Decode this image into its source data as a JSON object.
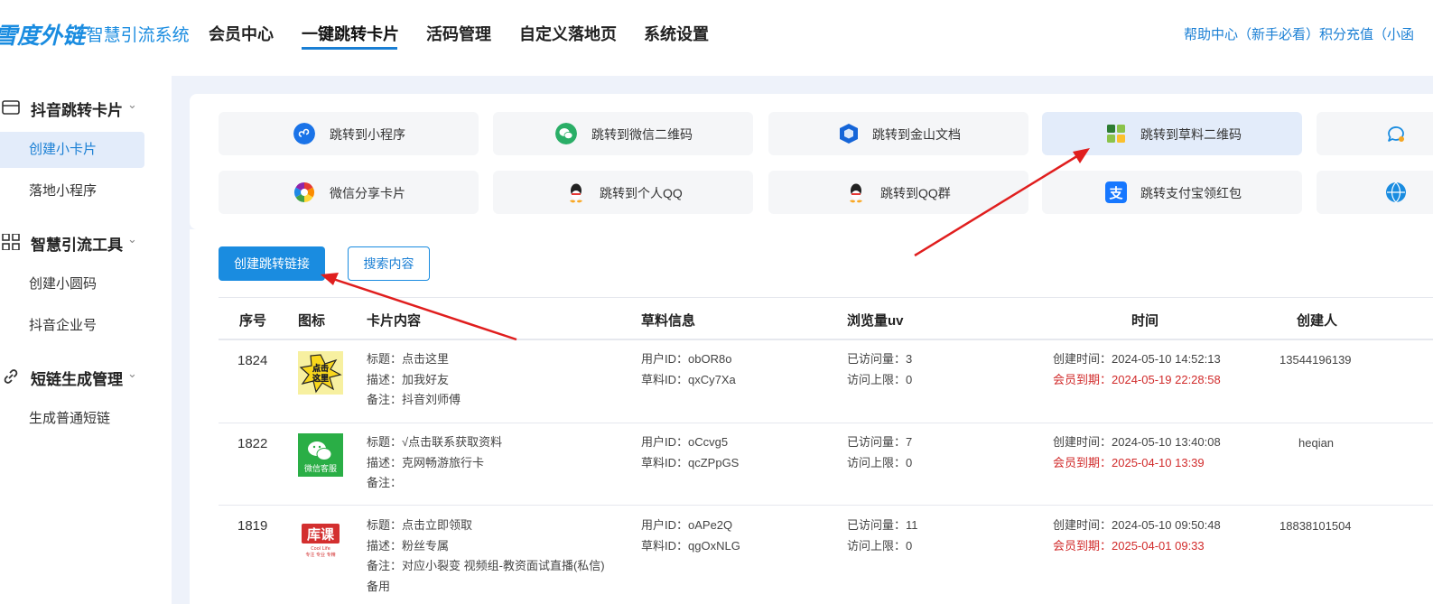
{
  "header": {
    "logo_main": "雪度外链",
    "logo_sub": "· 智慧引流系统",
    "nav": [
      "会员中心",
      "一键跳转卡片",
      "活码管理",
      "自定义落地页",
      "系统设置"
    ],
    "nav_active": "一键跳转卡片",
    "right_links": "帮助中心（新手必看）积分充值（小函"
  },
  "sidebar": {
    "groups": [
      {
        "label": "抖音跳转卡片",
        "items": [
          "创建小卡片",
          "落地小程序"
        ]
      },
      {
        "label": "智慧引流工具",
        "items": [
          "创建小圆码",
          "抖音企业号"
        ]
      },
      {
        "label": "短链生成管理",
        "items": [
          "生成普通短链"
        ]
      }
    ],
    "active_item": "创建小卡片"
  },
  "tiles": [
    {
      "label": "跳转到小程序",
      "icon": "mini-program-icon",
      "color": "#1a73e8"
    },
    {
      "label": "跳转到微信二维码",
      "icon": "wechat-icon",
      "color": "#2aae67"
    },
    {
      "label": "跳转到金山文档",
      "icon": "kingsoft-doc-icon",
      "color": "#1565d8"
    },
    {
      "label": "跳转到草料二维码",
      "icon": "caoliao-qrcode-icon",
      "color": "#4caf50"
    },
    {
      "label": "微信分享卡片",
      "icon": "share-card-icon",
      "color": "#f5a623"
    },
    {
      "label": "跳转到个人QQ",
      "icon": "qq-icon",
      "color": "#222222"
    },
    {
      "label": "跳转到QQ群",
      "icon": "qq-group-icon",
      "color": "#222222"
    },
    {
      "label": "跳转支付宝领红包",
      "icon": "alipay-icon",
      "color": "#1677ff"
    }
  ],
  "buttons": {
    "create": "创建跳转链接",
    "search": "搜索内容"
  },
  "table": {
    "headers": [
      "序号",
      "图标",
      "卡片内容",
      "草料信息",
      "浏览量uv",
      "时间",
      "创建人"
    ],
    "rows": [
      {
        "id": "1824",
        "thumb_text": "点击这里",
        "title": "标题：点击这里",
        "desc": "描述：加我好友",
        "note": "备注：抖音刘师傅",
        "note2": "",
        "user_id": "用户ID：obOR8o",
        "cl_id": "草料ID：qxCy7Xa",
        "visits": "已访问量：3",
        "limit": "访问上限：0",
        "created": "创建时间：2024-05-10 14:52:13",
        "expire": "会员到期：2024-05-19 22:28:58",
        "creator": "13544196139"
      },
      {
        "id": "1822",
        "thumb_text": "微信客服",
        "title": "标题：√点击联系获取资料",
        "desc": "描述：克网畅游旅行卡",
        "note": "备注：",
        "note2": "",
        "user_id": "用户ID：oCcvg5",
        "cl_id": "草料ID：qcZPpGS",
        "visits": "已访问量：7",
        "limit": "访问上限：0",
        "created": "创建时间：2024-05-10 13:40:08",
        "expire": "会员到期：2025-04-10 13:39",
        "creator": "heqian"
      },
      {
        "id": "1819",
        "thumb_text": "库课",
        "title": "标题：点击立即领取",
        "desc": "描述：粉丝专属",
        "note": "备注：对应小裂变 视频组-教资面试直播(私信)",
        "note2": "备用",
        "user_id": "用户ID：oAPe2Q",
        "cl_id": "草料ID：qgOxNLG",
        "visits": "已访问量：11",
        "limit": "访问上限：0",
        "created": "创建时间：2024-05-10 09:50:48",
        "expire": "会员到期：2025-04-01 09:33",
        "creator": "18838101504"
      }
    ]
  },
  "colors": {
    "accent": "#1a8ce0",
    "expire_red": "#d12b2b",
    "annotation_arrow": "#e01e1e"
  }
}
